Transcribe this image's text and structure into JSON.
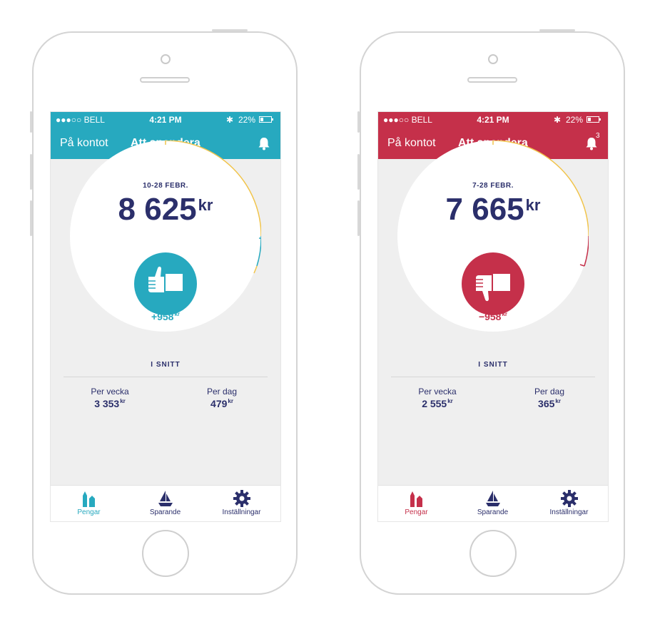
{
  "colors": {
    "teal": "#27a9bf",
    "red": "#c5304a",
    "navy": "#2b2f6b",
    "yellow": "#f1c44b"
  },
  "phones": [
    {
      "status": {
        "carrier": "●●●○○ BELL",
        "time": "4:21 PM",
        "bluetooth": "✱",
        "battery": "22%"
      },
      "nav": {
        "left": "På kontot",
        "title": "Att spendera",
        "notifications": ""
      },
      "gauge": {
        "period": "10-28 FEBR.",
        "amount": "8 625",
        "unit": "kr",
        "diff": "+958",
        "diff_unit": "kr",
        "thumb": "thumbs-up-icon"
      },
      "average": {
        "title": "I SNITT",
        "per_week_label": "Per vecka",
        "per_week": "3 353",
        "per_day_label": "Per dag",
        "per_day": "479",
        "unit": "kr"
      },
      "tabs": [
        {
          "label": "Pengar",
          "icon": "money-icon"
        },
        {
          "label": "Sparande",
          "icon": "sailboat-icon"
        },
        {
          "label": "Inställningar",
          "icon": "gear-icon"
        }
      ]
    },
    {
      "status": {
        "carrier": "●●●○○ BELL",
        "time": "4:21 PM",
        "bluetooth": "✱",
        "battery": "22%"
      },
      "nav": {
        "left": "På kontot",
        "title": "Att spendera",
        "notifications": "3"
      },
      "gauge": {
        "period": "7-28 FEBR.",
        "amount": "7 665",
        "unit": "kr",
        "diff": "−958",
        "diff_unit": "kr",
        "thumb": "thumbs-down-icon"
      },
      "average": {
        "title": "I SNITT",
        "per_week_label": "Per vecka",
        "per_week": "2 555",
        "per_day_label": "Per dag",
        "per_day": "365",
        "unit": "kr"
      },
      "tabs": [
        {
          "label": "Pengar",
          "icon": "money-icon"
        },
        {
          "label": "Sparande",
          "icon": "sailboat-icon"
        },
        {
          "label": "Inställningar",
          "icon": "gear-icon"
        }
      ]
    }
  ]
}
